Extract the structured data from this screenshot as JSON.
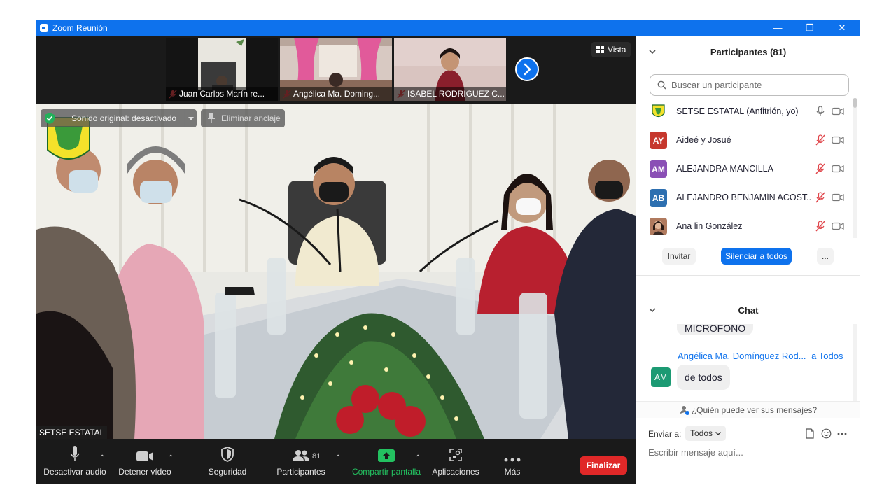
{
  "window": {
    "title": "Zoom Reunión",
    "controls": {
      "minimize": "—",
      "restore": "❐",
      "close": "✕"
    }
  },
  "thumbnails": [
    {
      "name": "Juan Carlos Marín re...",
      "muted": true
    },
    {
      "name": "Angélica Ma. Doming...",
      "muted": true
    },
    {
      "name": "ISABEL RODRIGUEZ C...",
      "muted": true
    }
  ],
  "view_button": {
    "label": "Vista"
  },
  "video_controls": {
    "original_sound": "Sonido original: desactivado",
    "unpin": "Eliminar anclaje"
  },
  "active_speaker": "SETSE ESTATAL",
  "toolbar": {
    "mute": "Desactivar audio",
    "video": "Detener vídeo",
    "security": "Seguridad",
    "participants": "Participantes",
    "participants_count": "81",
    "share": "Compartir pantalla",
    "apps": "Aplicaciones",
    "more": "Más",
    "end": "Finalizar"
  },
  "participants_panel": {
    "title": "Participantes (81)",
    "search_placeholder": "Buscar un participante",
    "participants": [
      {
        "name": "SETSE ESTATAL (Anfitrión, yo)",
        "initials": "",
        "color": "#ffffff",
        "mic": "on",
        "video": "off"
      },
      {
        "name": "Aideé y Josué",
        "initials": "AY",
        "color": "#c6372d",
        "mic": "muted",
        "video": "off"
      },
      {
        "name": "ALEJANDRA MANCILLA",
        "initials": "AM",
        "color": "#8a4fb5",
        "mic": "muted",
        "video": "off"
      },
      {
        "name": "ALEJANDRO BENJAMÍN ACOST...",
        "initials": "AB",
        "color": "#2d6fb0",
        "mic": "muted",
        "video": "off"
      },
      {
        "name": "Ana lin González",
        "initials": "",
        "color": "#b07a5e",
        "mic": "muted",
        "video": "off"
      }
    ],
    "invite": "Invitar",
    "mute_all": "Silenciar a todos",
    "more": "..."
  },
  "chat_panel": {
    "title": "Chat",
    "messages": [
      {
        "text": "MICROFONO"
      },
      {
        "sender": "Angélica Ma. Domínguez Rod...",
        "to": "a Todos",
        "initials": "AM",
        "color": "#1c9a73",
        "text": "de todos"
      }
    ],
    "who_can_see": "¿Quién puede ver sus mensajes?",
    "send_to_label": "Enviar a:",
    "send_to_value": "Todos",
    "input_placeholder": "Escribir mensaje aquí..."
  }
}
